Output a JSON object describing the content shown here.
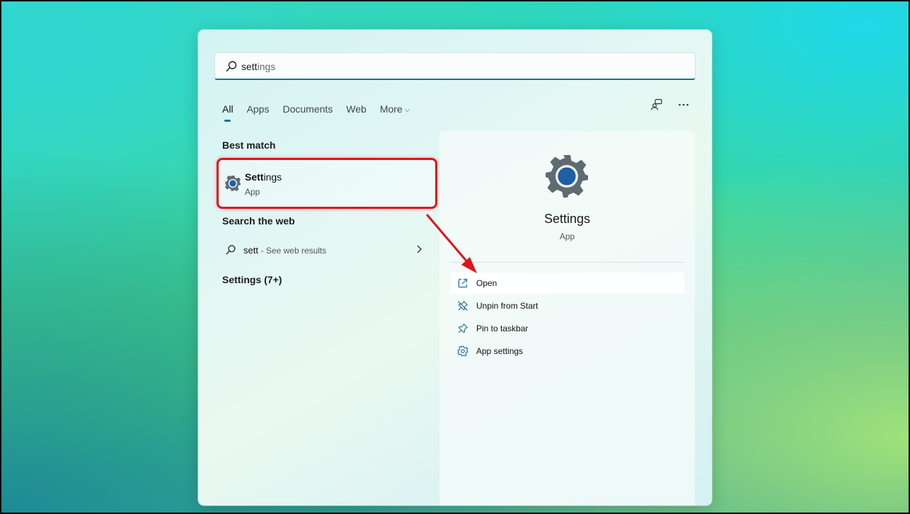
{
  "search": {
    "typed": "sett",
    "completion": "ings"
  },
  "tabs": [
    {
      "label": "All",
      "active": true
    },
    {
      "label": "Apps"
    },
    {
      "label": "Documents"
    },
    {
      "label": "Web"
    },
    {
      "label": "More"
    }
  ],
  "more_chevron": "⌵",
  "best_match": {
    "heading": "Best match",
    "name_bold": "Sett",
    "name_rest": "ings",
    "type": "App"
  },
  "web": {
    "heading": "Search the web",
    "query": "sett",
    "suffix": "- See web results"
  },
  "settings_more": {
    "heading": "Settings (7+)"
  },
  "details": {
    "title": "Settings",
    "subtitle": "App",
    "actions": [
      {
        "label": "Open",
        "icon": "open-external-icon"
      },
      {
        "label": "Unpin from Start",
        "icon": "unpin-icon"
      },
      {
        "label": "Pin to taskbar",
        "icon": "pin-icon"
      },
      {
        "label": "App settings",
        "icon": "gear-icon"
      }
    ]
  },
  "colors": {
    "accent": "#1c6f8e",
    "annotation": "#e0121b",
    "gear_blue": "#1d5fa8",
    "gear_gray": "#5f6a72"
  }
}
